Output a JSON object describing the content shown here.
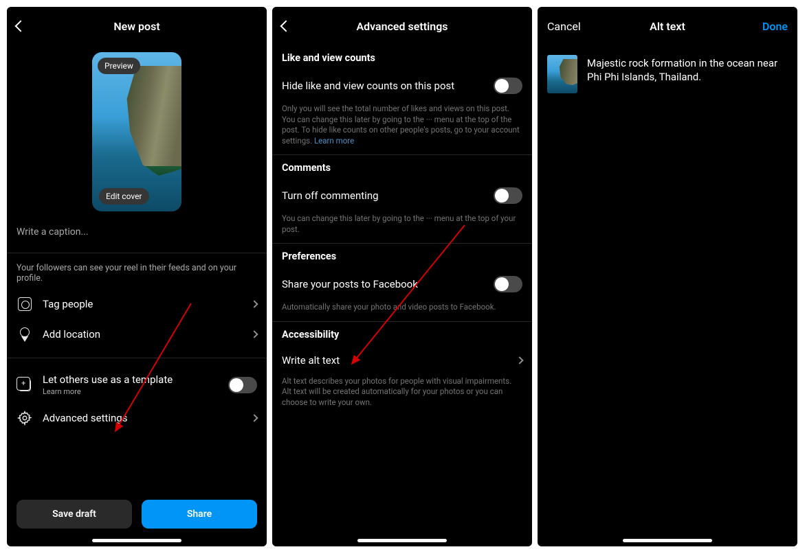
{
  "screen1": {
    "title": "New post",
    "preview_label": "Preview",
    "editcover_label": "Edit cover",
    "caption_placeholder": "Write a caption...",
    "followers_note": "Your followers can see your reel in their feeds and on your profile.",
    "row_tag": "Tag people",
    "row_location": "Add location",
    "row_template": "Let others use as a template",
    "row_template_sub": "Learn more",
    "row_advanced": "Advanced settings",
    "btn_savedraft": "Save draft",
    "btn_share": "Share"
  },
  "screen2": {
    "title": "Advanced settings",
    "section_like": "Like and view counts",
    "row_hidecounts": "Hide like and view counts on this post",
    "help_hidecounts": "Only you will see the total number of likes and views on this post. You can change this later by going to the ··· menu at the top of the post. To hide like counts on other people's posts, go to your account settings. ",
    "help_hidecounts_link": "Learn more",
    "section_comments": "Comments",
    "row_turnoffcomments": "Turn off commenting",
    "help_turnoffcomments": "You can change this later by going to the ··· menu at the top of your post.",
    "section_prefs": "Preferences",
    "row_sharefb": "Share your posts to Facebook",
    "help_sharefb": "Automatically share your photo and video posts to Facebook.",
    "section_access": "Accessibility",
    "row_alttext": "Write alt text",
    "help_alttext": "Alt text describes your photos for people with visual impairments. Alt text will be created automatically for your photos or you can choose to write your own."
  },
  "screen3": {
    "cancel": "Cancel",
    "title": "Alt text",
    "done": "Done",
    "alt_value": "Majestic rock formation in the ocean near Phi Phi Islands, Thailand."
  },
  "colors": {
    "accent": "#0095f6"
  }
}
